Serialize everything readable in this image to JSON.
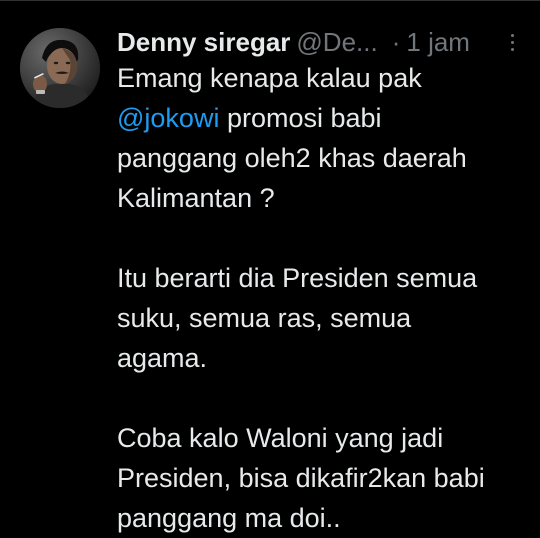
{
  "tweet": {
    "author": {
      "display_name": "Denny siregar",
      "handle": "@De...",
      "avatar_icon": "user-avatar"
    },
    "separator": "·",
    "time": "1 jam",
    "more_icon": "more-vertical-icon",
    "paragraphs": [
      {
        "lines": [
          "Emang kenapa kalau pak",
          {
            "mention": "@jokowi",
            "rest": " promosi babi"
          },
          "panggang oleh2 khas daerah",
          "Kalimantan ?"
        ]
      },
      {
        "lines": [
          "Itu berarti dia Presiden semua",
          "suku, semua ras, semua",
          "agama."
        ]
      },
      {
        "lines": [
          "Coba kalo Waloni yang jadi",
          "Presiden, bisa dikafir2kan babi",
          "panggang ma doi.."
        ]
      }
    ]
  },
  "colors": {
    "background": "#000000",
    "text": "#e7e9ea",
    "secondary": "#71767b",
    "link": "#1d9bf0"
  }
}
